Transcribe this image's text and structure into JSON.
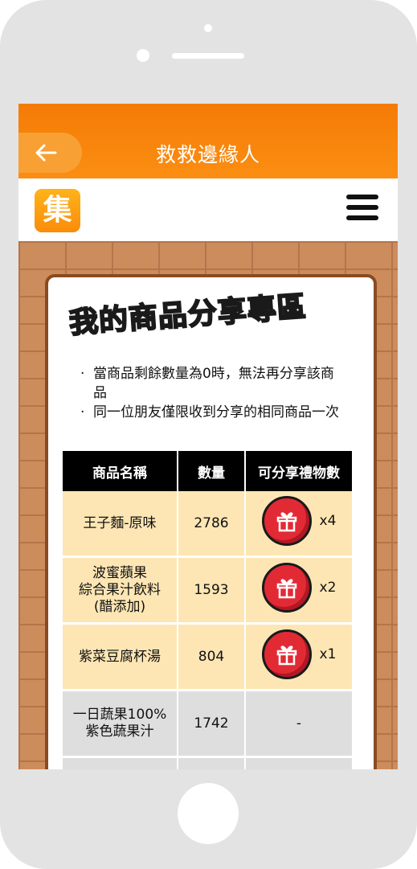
{
  "header": {
    "title": "救救邊緣人",
    "back_icon": "back-arrow-icon"
  },
  "brand": {
    "logo_text": "集",
    "menu_icon": "hamburger-menu-icon"
  },
  "heading": {
    "part1": "我的",
    "part2": "商品分享專區"
  },
  "notes": [
    "當商品剩餘數量為0時，無法再分享該商品",
    "同一位朋友僅限收到分享的相同商品一次"
  ],
  "table": {
    "headers": [
      "商品名稱",
      "數量",
      "可分享禮物數"
    ],
    "rows": [
      {
        "name": "王子麵-原味",
        "qty": "2786",
        "gift": "x4"
      },
      {
        "name": "波蜜蘋果\n綜合果汁飲料\n(醋添加)",
        "qty": "1593",
        "gift": "x2"
      },
      {
        "name": "紫菜豆腐杯湯",
        "qty": "804",
        "gift": "x1"
      },
      {
        "name": "一日蔬果100%\n紫色蔬果汁",
        "qty": "1742",
        "gift": "-"
      }
    ]
  },
  "colors": {
    "brand": "#f47b06",
    "gift": "#e22a35",
    "brick": "#cd8c5c"
  }
}
